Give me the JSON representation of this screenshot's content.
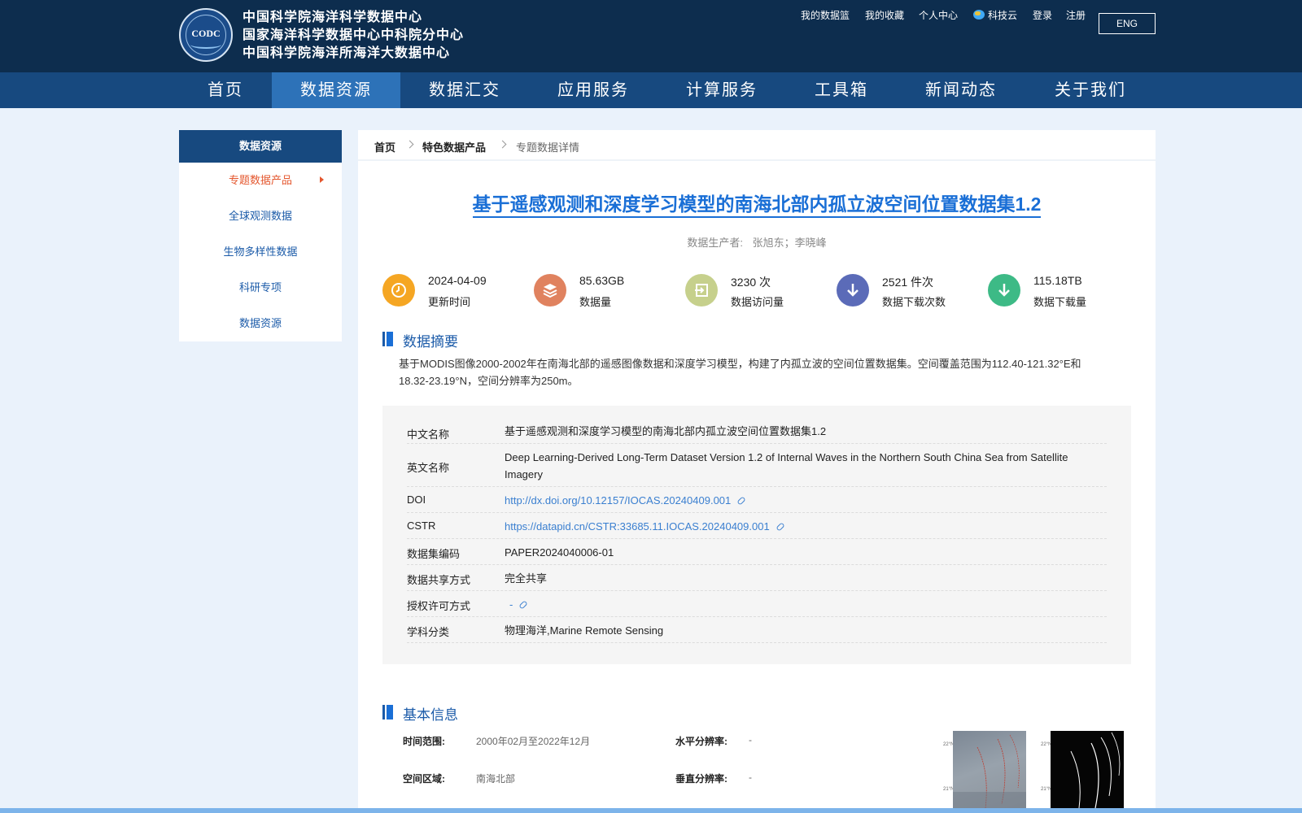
{
  "header": {
    "logo_text": "CODC",
    "org_lines": [
      "中国科学院海洋科学数据中心",
      "国家海洋科学数据中心中科院分中心",
      "中国科学院海洋所海洋大数据中心"
    ],
    "top_links": [
      "我的数据篮",
      "我的收藏",
      "个人中心",
      "科技云",
      "登录",
      "注册"
    ],
    "lang_button": "ENG"
  },
  "nav": {
    "items": [
      "首页",
      "数据资源",
      "数据汇交",
      "应用服务",
      "计算服务",
      "工具箱",
      "新闻动态",
      "关于我们"
    ],
    "active": "数据资源"
  },
  "sidebar": {
    "title": "数据资源",
    "items": [
      "专题数据产品",
      "全球观测数据",
      "生物多样性数据",
      "科研专项",
      "数据资源"
    ]
  },
  "breadcrumb": [
    "首页",
    "特色数据产品",
    "专题数据详情"
  ],
  "dataset": {
    "title": "基于遥感观测和深度学习模型的南海北部内孤立波空间位置数据集1.2",
    "producer_label": "数据生产者:",
    "producers": "张旭东；李晓峰"
  },
  "stats": [
    {
      "value": "2024-04-09",
      "label": "更新时间",
      "icon": "clock-icon",
      "color": "#f5a623"
    },
    {
      "value": "85.63GB",
      "label": "数据量",
      "icon": "layers-icon",
      "color": "#e0825f"
    },
    {
      "value": "3230 次",
      "label": "数据访问量",
      "icon": "enter-icon",
      "color": "#c6d08c"
    },
    {
      "value": "2521 件次",
      "label": "数据下载次数",
      "icon": "download-icon",
      "color": "#5b6bb8"
    },
    {
      "value": "115.18TB",
      "label": "数据下载量",
      "icon": "download-icon",
      "color": "#3dba86"
    }
  ],
  "abstract": {
    "heading": "数据摘要",
    "text": "基于MODIS图像2000-2002年在南海北部的遥感图像数据和深度学习模型，构建了内孤立波的空间位置数据集。空间覆盖范围为112.40-121.32°E和18.32-23.19°N，空间分辨率为250m。"
  },
  "meta": {
    "rows": [
      {
        "key": "中文名称",
        "value": "基于遥感观测和深度学习模型的南海北部内孤立波空间位置数据集1.2"
      },
      {
        "key": "英文名称",
        "value": "Deep Learning-Derived Long-Term Dataset Version 1.2 of Internal Waves in the Northern South China Sea from Satellite Imagery"
      },
      {
        "key": "DOI",
        "value": "http://dx.doi.org/10.12157/IOCAS.20240409.001"
      },
      {
        "key": "CSTR",
        "value": "https://datapid.cn/CSTR:33685.11.IOCAS.20240409.001"
      },
      {
        "key": "数据集编码",
        "value": "PAPER2024040006-01"
      },
      {
        "key": "数据共享方式",
        "value": "完全共享"
      },
      {
        "key": "授权许可方式",
        "value": "-"
      },
      {
        "key": "学科分类",
        "value": "物理海洋,Marine Remote Sensing"
      }
    ]
  },
  "basic_info": {
    "heading": "基本信息",
    "time_range_label": "时间范围:",
    "time_range": "2000年02月至2022年12月",
    "region_label": "空间区域:",
    "region": "南海北部",
    "h_res_label": "水平分辨率:",
    "h_res": "-",
    "v_res_label": "垂直分辨率:",
    "v_res": "-",
    "thumb_labels": [
      "22°N",
      "21°N"
    ]
  },
  "colors": {
    "header_bg": "#0d2d4e",
    "nav_bg": "#17497f",
    "nav_active": "#2d72b8",
    "title_blue": "#1a6fd6",
    "sidebar_active": "#e4572e"
  }
}
